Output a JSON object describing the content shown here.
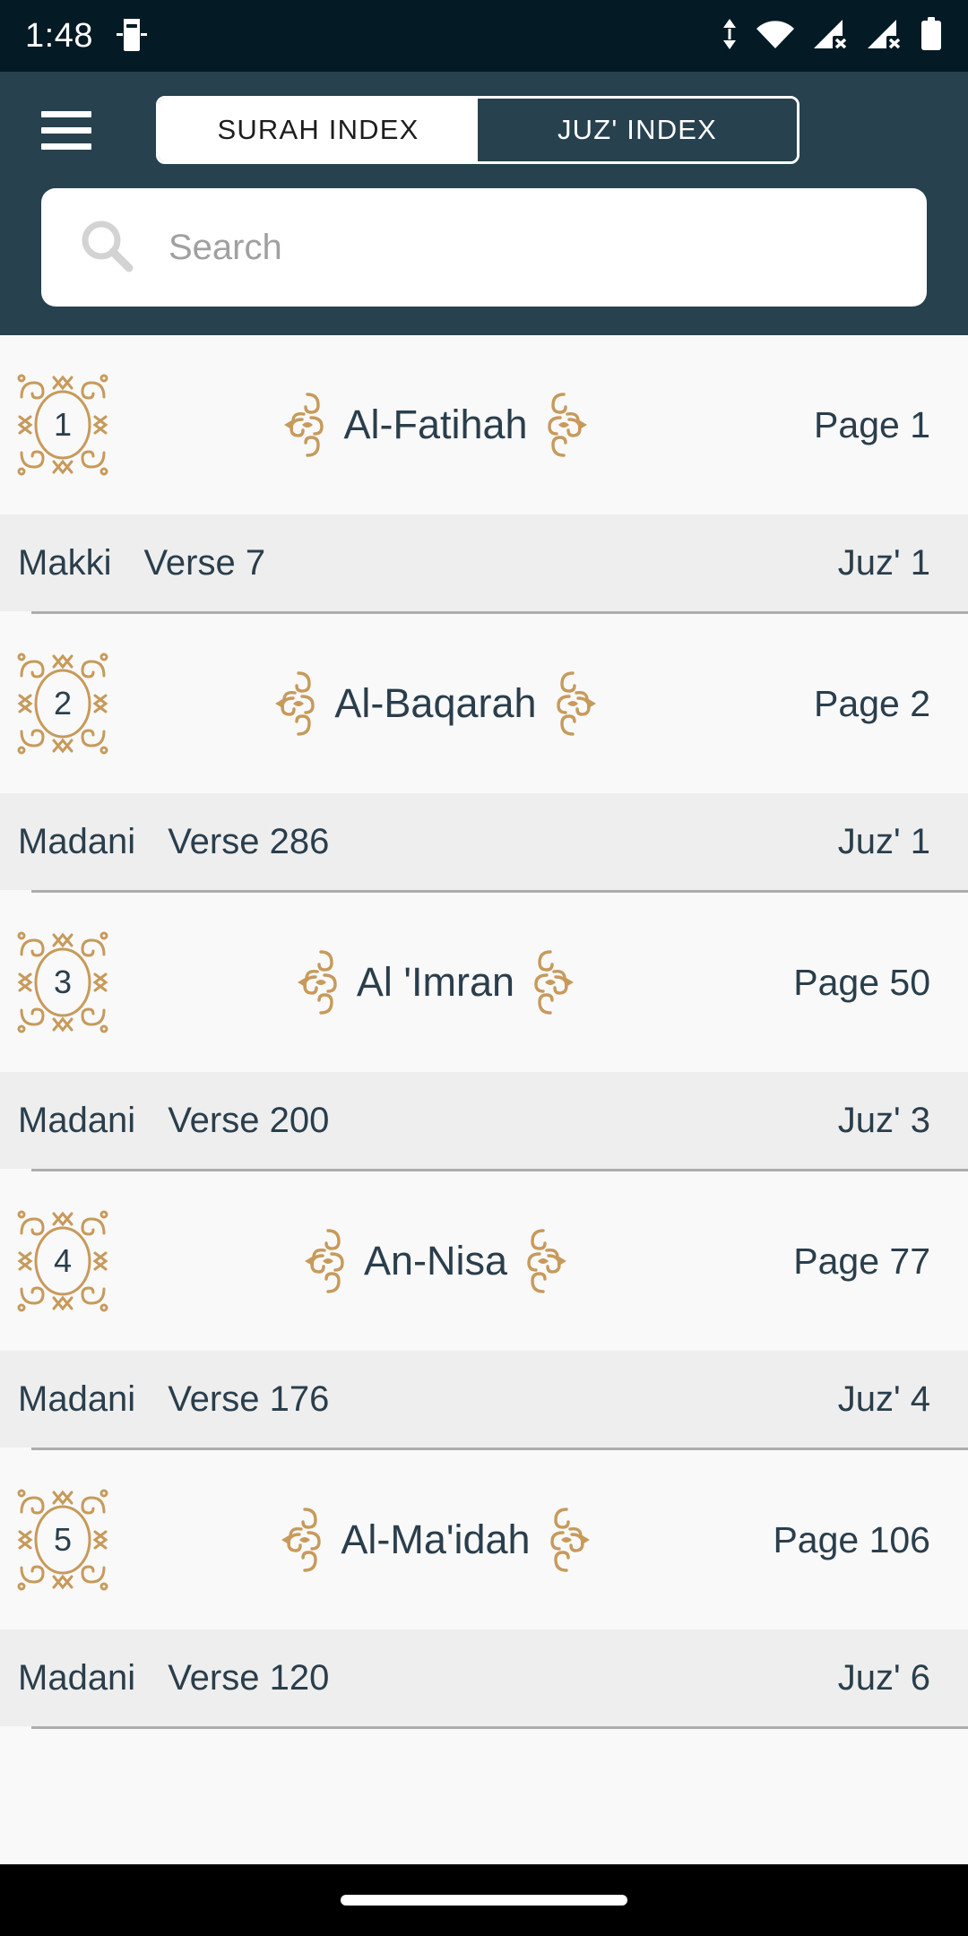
{
  "status_bar": {
    "time": "1:48",
    "left_icons": [
      "screen-cast-icon"
    ],
    "right_icons": [
      "data-transfer-icon",
      "wifi-icon",
      "signal-no-sim-1-icon",
      "signal-no-sim-2-icon",
      "battery-full-icon"
    ]
  },
  "header": {
    "menu_icon": "hamburger-menu-icon",
    "tabs": [
      {
        "label": "SURAH INDEX",
        "active": true
      },
      {
        "label": "JUZ' INDEX",
        "active": false
      }
    ]
  },
  "search": {
    "icon": "search-icon",
    "value": "",
    "placeholder": "Search"
  },
  "colors": {
    "header_bg": "#27414F",
    "status_bar_bg": "#041A24",
    "row_bg": "#F9F9F9",
    "meta_bg": "#EEEEEE",
    "text_primary": "#2A3E4C",
    "gold": "#C79A5B",
    "separator": "#ADADAD",
    "nav_bg": "#000000"
  },
  "list": {
    "items": [
      {
        "number": "1",
        "name": "Al-Fatihah",
        "page": "Page 1",
        "revelation": "Makki",
        "verses": "Verse 7",
        "juz": "Juz' 1"
      },
      {
        "number": "2",
        "name": "Al-Baqarah",
        "page": "Page 2",
        "revelation": "Madani",
        "verses": "Verse 286",
        "juz": "Juz' 1"
      },
      {
        "number": "3",
        "name": "Al 'Imran",
        "page": "Page 50",
        "revelation": "Madani",
        "verses": "Verse 200",
        "juz": "Juz' 3"
      },
      {
        "number": "4",
        "name": "An-Nisa",
        "page": "Page 77",
        "revelation": "Madani",
        "verses": "Verse 176",
        "juz": "Juz' 4"
      },
      {
        "number": "5",
        "name": "Al-Ma'idah",
        "page": "Page 106",
        "revelation": "Madani",
        "verses": "Verse 120",
        "juz": "Juz' 6"
      }
    ]
  },
  "bottom_nav": {
    "gesture_pill": "home-gesture-pill"
  }
}
